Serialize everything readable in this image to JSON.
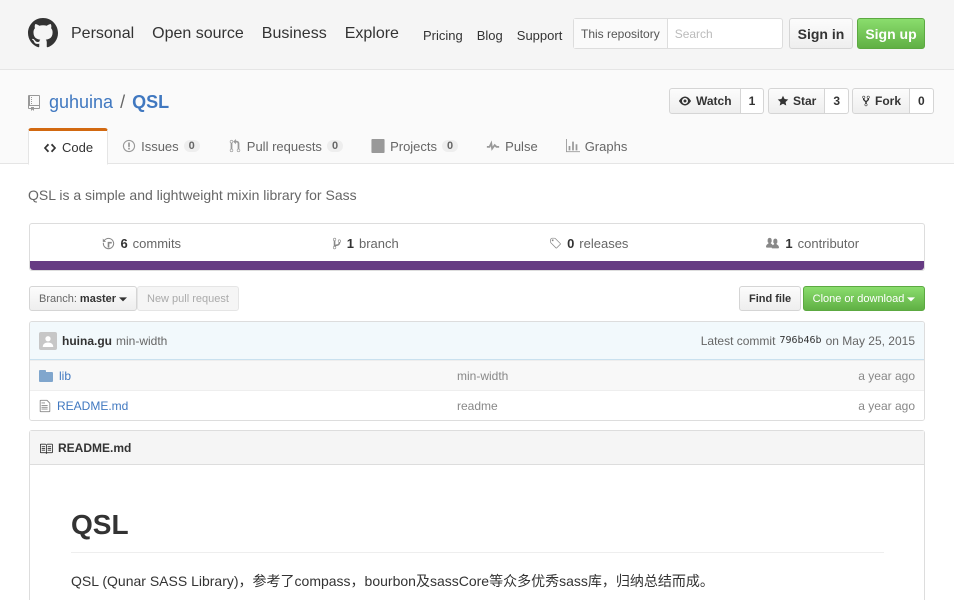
{
  "header": {
    "nav_main": [
      "Personal",
      "Open source",
      "Business",
      "Explore"
    ],
    "nav_sub": [
      "Pricing",
      "Blog",
      "Support"
    ],
    "search_scope": "This repository",
    "search_placeholder": "Search",
    "sign_in": "Sign in",
    "sign_up": "Sign up"
  },
  "repo": {
    "owner": "guhuina",
    "separator": "/",
    "name": "QSL",
    "watch_label": "Watch",
    "watch_count": "1",
    "star_label": "Star",
    "star_count": "3",
    "fork_label": "Fork",
    "fork_count": "0"
  },
  "tabs": [
    {
      "label": "Code",
      "counter": null,
      "icon": "code-icon",
      "active": true
    },
    {
      "label": "Issues",
      "counter": "0",
      "icon": "issue-icon",
      "active": false
    },
    {
      "label": "Pull requests",
      "counter": "0",
      "icon": "pull-request-icon",
      "active": false
    },
    {
      "label": "Projects",
      "counter": "0",
      "icon": "project-icon",
      "active": false
    },
    {
      "label": "Pulse",
      "counter": null,
      "icon": "pulse-icon",
      "active": false
    },
    {
      "label": "Graphs",
      "counter": null,
      "icon": "graph-icon",
      "active": false
    }
  ],
  "description": "QSL is a simple and lightweight mixin library for Sass",
  "summary": {
    "commits_count": "6",
    "commits_label": "commits",
    "branch_count": "1",
    "branch_label": "branch",
    "releases_count": "0",
    "releases_label": "releases",
    "contributor_count": "1",
    "contributor_label": "contributor",
    "language_color": "#663b83"
  },
  "toolbar": {
    "branch_prefix": "Branch:",
    "branch_name": "master",
    "new_pull_request": "New pull request",
    "find_file": "Find file",
    "clone_download": "Clone or download"
  },
  "commit": {
    "author": "huina.gu",
    "message": "min-width",
    "latest_label": "Latest commit",
    "sha": "796b46b",
    "date": "on May 25, 2015"
  },
  "files": [
    {
      "name": "lib",
      "type": "folder",
      "message": "min-width",
      "age": "a year ago"
    },
    {
      "name": "README.md",
      "type": "file",
      "message": "readme",
      "age": "a year ago"
    }
  ],
  "readme": {
    "header_label": "README.md",
    "h1": "QSL",
    "paragraph": "QSL (Qunar SASS Library)，参考了compass，bourbon及sassCore等众多优秀sass库，归纳总结而成。"
  },
  "colors": {
    "link": "#4078c0",
    "signup_green": "#60b044",
    "active_tab_accent": "#d26911"
  }
}
